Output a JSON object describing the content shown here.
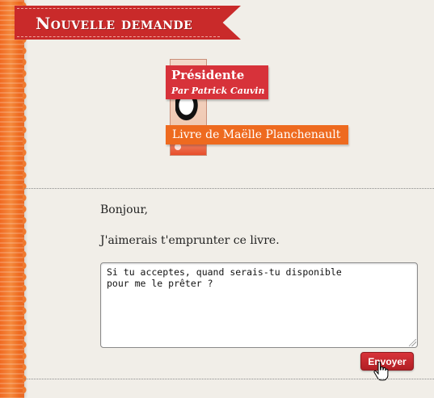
{
  "header": {
    "title": "Nouvelle demande"
  },
  "book": {
    "title": "Présidente",
    "author": "Par Patrick Cauvin",
    "owner_label": "Livre de Maëlle Planchenault"
  },
  "message": {
    "greeting": "Bonjour,",
    "request": "J'aimerais t'emprunter ce livre.",
    "body": "Si tu acceptes, quand serais-tu disponible\npour me le prêter ?"
  },
  "actions": {
    "send_label": "Envoyer"
  },
  "colors": {
    "accent_red": "#c92a2a",
    "accent_orange": "#ee6a1f",
    "background": "#f1eee8"
  },
  "icons": {
    "cursor": "hand-pointer-icon"
  }
}
